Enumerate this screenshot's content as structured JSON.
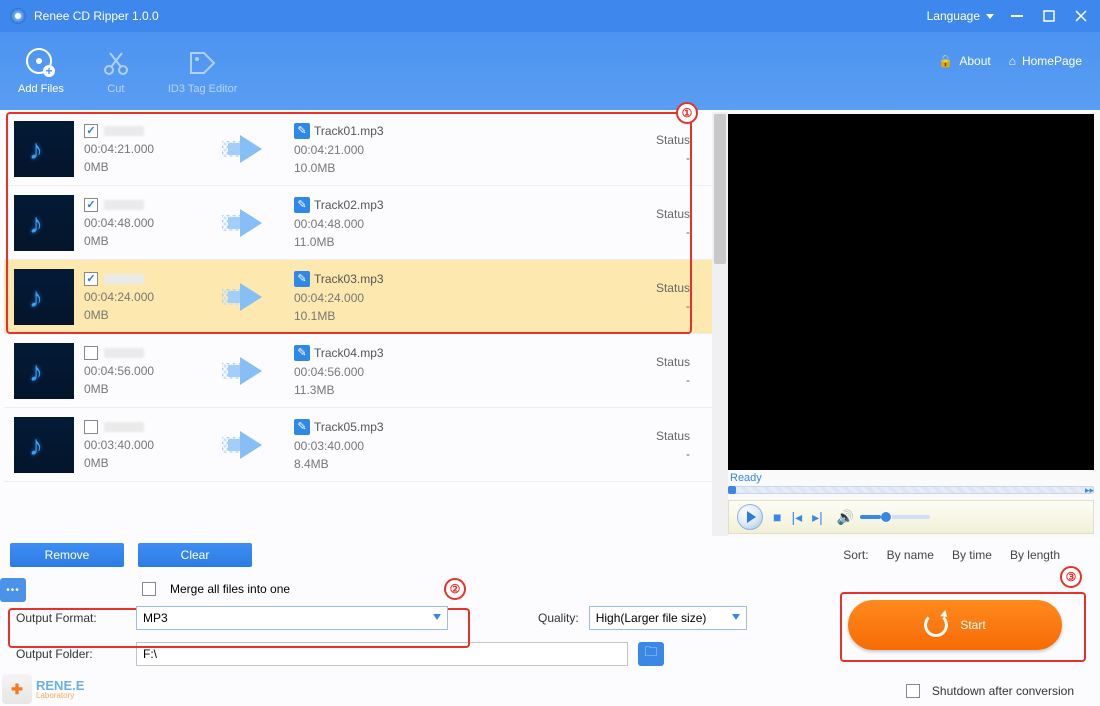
{
  "title": "Renee CD Ripper 1.0.0",
  "language_label": "Language",
  "toolbar": {
    "add_files": "Add Files",
    "cut": "Cut",
    "id3": "ID3 Tag Editor",
    "about": "About",
    "homepage": "HomePage"
  },
  "status_header": "Status",
  "tracks": [
    {
      "checked": true,
      "duration": "00:04:21.000",
      "size": "0MB",
      "out": "Track01.mp3",
      "out_dur": "00:04:21.000",
      "out_size": "10.0MB",
      "status": "-",
      "sel": false
    },
    {
      "checked": true,
      "duration": "00:04:48.000",
      "size": "0MB",
      "out": "Track02.mp3",
      "out_dur": "00:04:48.000",
      "out_size": "11.0MB",
      "status": "-",
      "sel": false
    },
    {
      "checked": true,
      "duration": "00:04:24.000",
      "size": "0MB",
      "out": "Track03.mp3",
      "out_dur": "00:04:24.000",
      "out_size": "10.1MB",
      "status": "-",
      "sel": true
    },
    {
      "checked": false,
      "duration": "00:04:56.000",
      "size": "0MB",
      "out": "Track04.mp3",
      "out_dur": "00:04:56.000",
      "out_size": "11.3MB",
      "status": "-",
      "sel": false
    },
    {
      "checked": false,
      "duration": "00:03:40.000",
      "size": "0MB",
      "out": "Track05.mp3",
      "out_dur": "00:03:40.000",
      "out_size": "8.4MB",
      "status": "-",
      "sel": false
    }
  ],
  "actions": {
    "remove": "Remove",
    "clear": "Clear"
  },
  "sort": {
    "label": "Sort:",
    "name": "By name",
    "time": "By time",
    "length": "By length"
  },
  "preview": {
    "ready": "Ready"
  },
  "merge": "Merge all files into one",
  "output_format_label": "Output Format:",
  "output_format_value": "MP3",
  "quality_label": "Quality:",
  "quality_value": "High(Larger file size)",
  "output_folder_label": "Output Folder:",
  "output_folder_value": "F:\\",
  "start": "Start",
  "shutdown": "Shutdown after conversion",
  "logo": {
    "brand": "RENE.E",
    "sub": "Laboratory"
  },
  "annotations": {
    "n1": "①",
    "n2": "②",
    "n3": "③"
  }
}
